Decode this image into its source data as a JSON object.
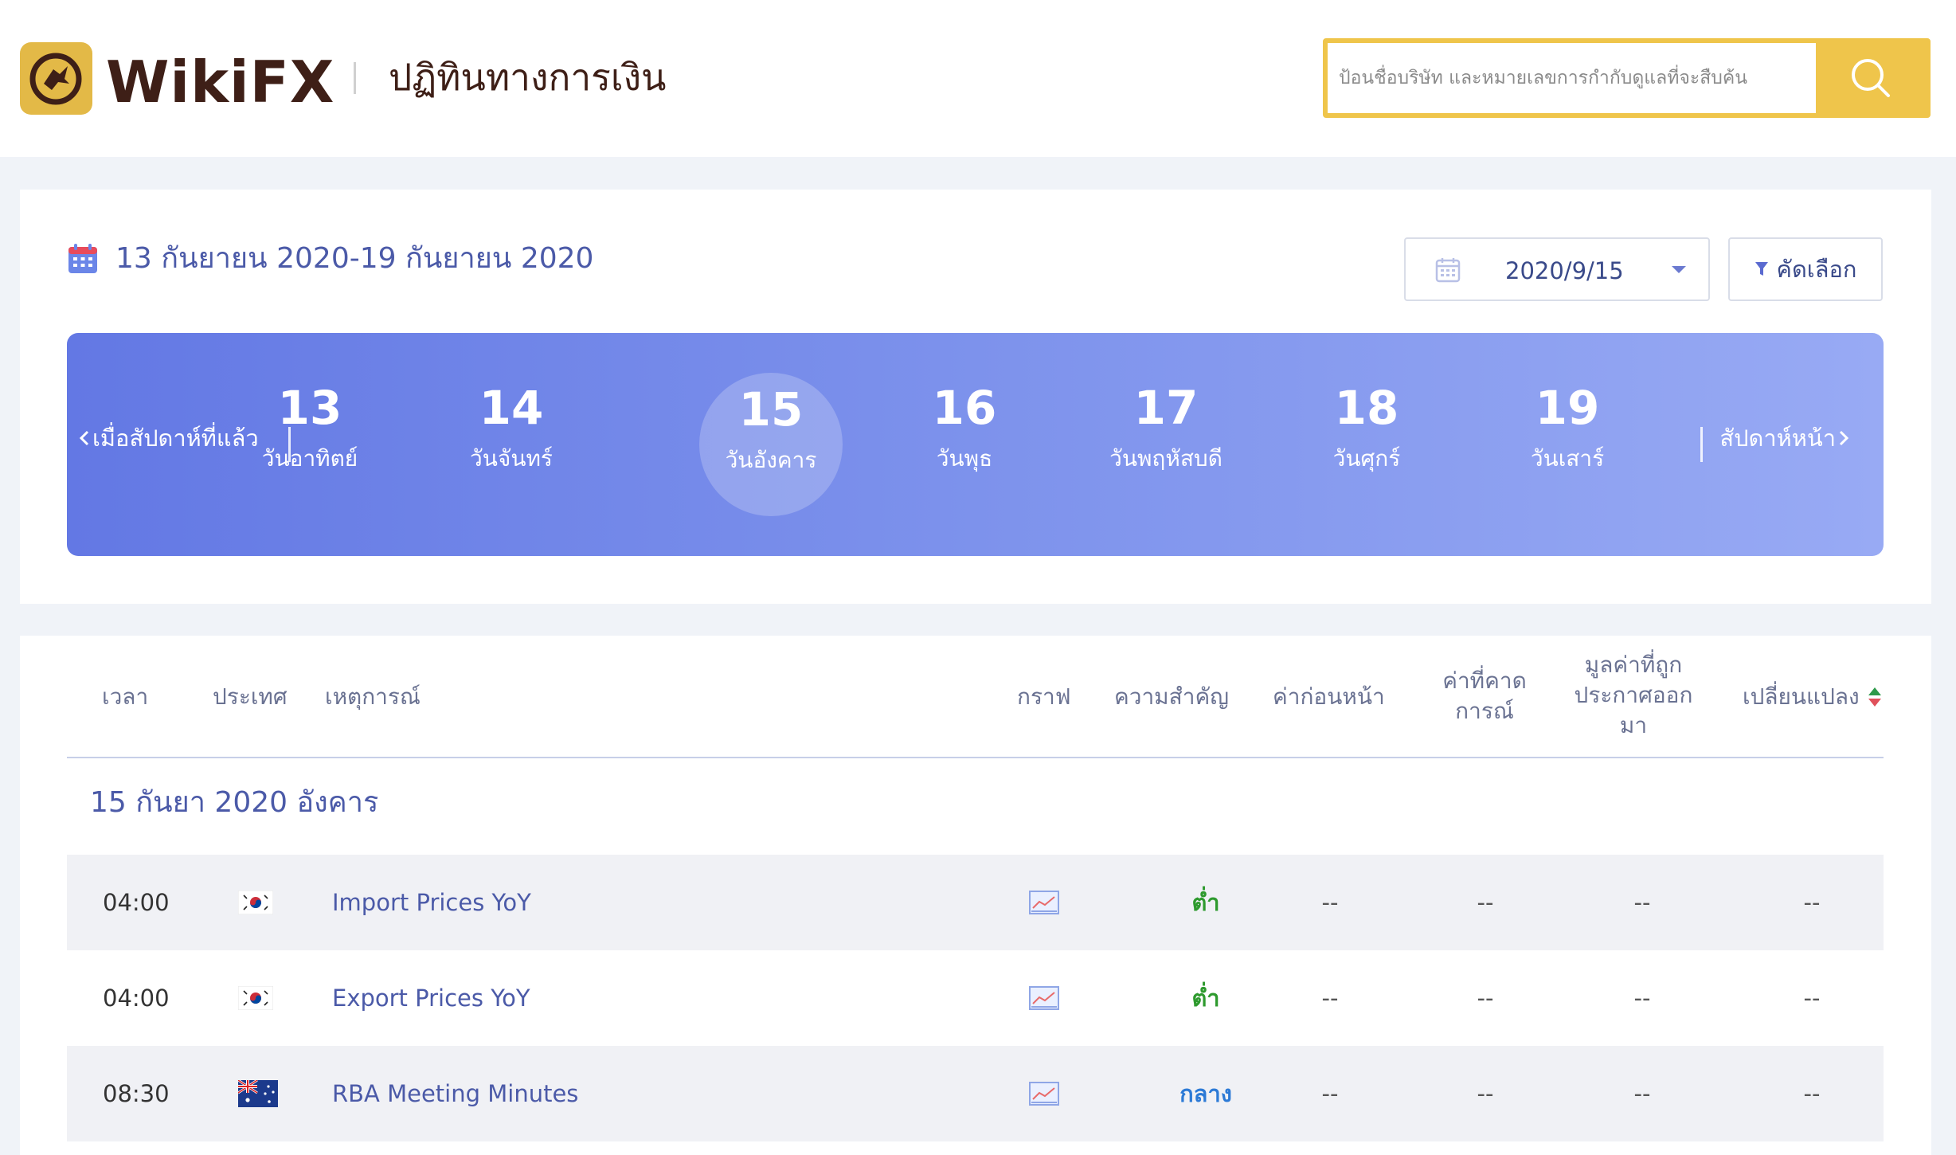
{
  "header": {
    "logo_text": "WikiFX",
    "page_title": "ปฏิทินทางการเงิน",
    "search_placeholder": "ป้อนชื่อบริษัท และหมายเลขการกำกับดูแลที่จะสืบค้น"
  },
  "calendar": {
    "week_range": "13 กันยายน 2020-19 กันยายน 2020",
    "date_value": "2020/9/15",
    "filter_label": "คัดเลือก",
    "prev_week_label": "เมื่อสัปดาห์ที่แล้ว",
    "next_week_label": "สัปดาห์หน้า",
    "days": [
      {
        "num": "13",
        "name": "วันอาทิตย์",
        "active": false
      },
      {
        "num": "14",
        "name": "วันจันทร์",
        "active": false
      },
      {
        "num": "15",
        "name": "วันอังคาร",
        "active": true
      },
      {
        "num": "16",
        "name": "วันพุธ",
        "active": false
      },
      {
        "num": "17",
        "name": "วันพฤหัสบดี",
        "active": false
      },
      {
        "num": "18",
        "name": "วันศุกร์",
        "active": false
      },
      {
        "num": "19",
        "name": "วันเสาร์",
        "active": false
      }
    ]
  },
  "table": {
    "headers": {
      "time": "เวลา",
      "country": "ประเทศ",
      "event": "เหตุการณ์",
      "chart": "กราฟ",
      "importance": "ความสำคัญ",
      "previous": "ค่าก่อนหน้า",
      "forecast_1": "ค่าที่คาด",
      "forecast_2": "การณ์",
      "actual_1": "มูลค่าที่ถูก",
      "actual_2": "ประกาศออก",
      "actual_3": "มา",
      "change": "เปลี่ยนแปลง"
    },
    "day_heading": "15 กันยา 2020 อังคาร",
    "rows": [
      {
        "time": "04:00",
        "flag": "south-korea-flag",
        "event": "Import Prices YoY",
        "importance": "ต่ำ",
        "importance_level": "low",
        "previous": "--",
        "forecast": "--",
        "actual": "--",
        "change": "--"
      },
      {
        "time": "04:00",
        "flag": "south-korea-flag",
        "event": "Export Prices YoY",
        "importance": "ต่ำ",
        "importance_level": "low",
        "previous": "--",
        "forecast": "--",
        "actual": "--",
        "change": "--"
      },
      {
        "time": "08:30",
        "flag": "australia-flag",
        "event": "RBA Meeting Minutes",
        "importance": "กลาง",
        "importance_level": "medium",
        "previous": "--",
        "forecast": "--",
        "actual": "--",
        "change": "--"
      }
    ]
  },
  "colors": {
    "brand_gold": "#efc54b",
    "brand_dark": "#3e1f17",
    "accent_blue": "#4b5aa8",
    "importance_low": "#2e9a2e",
    "importance_medium": "#2c7ad6"
  }
}
